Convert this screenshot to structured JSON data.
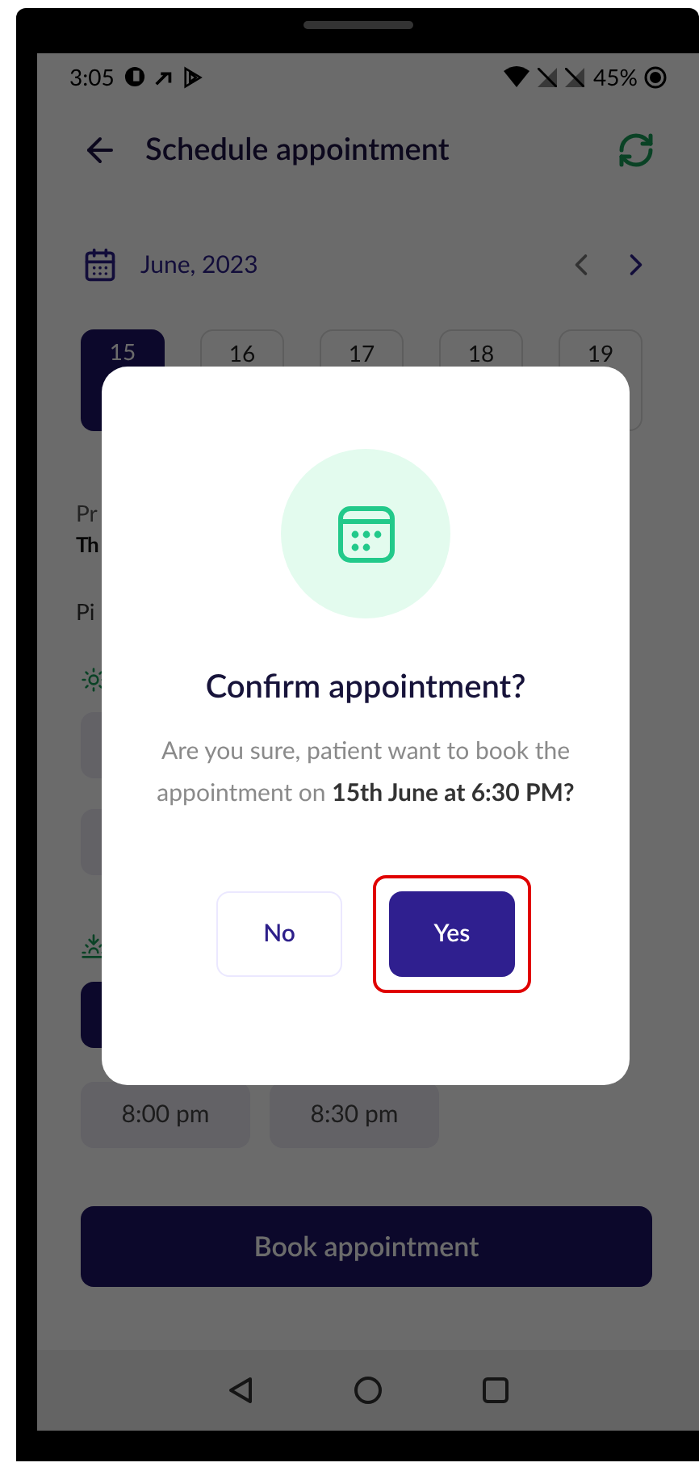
{
  "status_bar": {
    "time": "3:05",
    "battery": "45%"
  },
  "header": {
    "title": "Schedule appointment"
  },
  "calendar": {
    "month": "June, 2023",
    "days": [
      {
        "day": "15",
        "selected": true
      },
      {
        "day": "16",
        "selected": false
      },
      {
        "day": "17",
        "selected": false
      },
      {
        "day": "18",
        "selected": false
      },
      {
        "day": "19",
        "selected": false
      }
    ]
  },
  "details": {
    "label_1": "Pr",
    "value_1": "Th",
    "label_2": "Pi"
  },
  "morning_slots": [
    {
      "selected": false
    },
    {
      "selected": false
    }
  ],
  "evening_slots": [
    {
      "selected": true
    },
    {
      "label": "8:00 pm",
      "selected": false
    },
    {
      "label": "8:30 pm",
      "selected": false
    }
  ],
  "book_button": "Book appointment",
  "dialog": {
    "title": "Confirm appointment?",
    "message": "Are you sure, patient want to book the appointment on **15th June at 6:30 PM?**",
    "buttons": [
      {
        "label": "No",
        "kind": "secondary",
        "highlighted": false
      },
      {
        "label": "Yes",
        "kind": "primary",
        "highlighted": true
      }
    ]
  }
}
